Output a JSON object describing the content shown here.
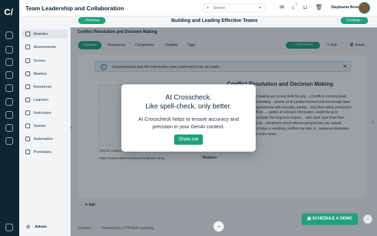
{
  "app": {
    "title": "Team Leadership and Collaboration"
  },
  "topbar": {
    "search_placeholder": "Search",
    "user_name": "Stephanie Brown",
    "badge_count": "3"
  },
  "sidebar": {
    "items": [
      {
        "label": "Modules",
        "icon": "modules-icon"
      },
      {
        "label": "Assessments",
        "icon": "assessments-icon"
      },
      {
        "label": "Scores",
        "icon": "scores-icon"
      },
      {
        "label": "Mastery",
        "icon": "mastery-icon"
      },
      {
        "label": "Resources",
        "icon": "resources-icon"
      },
      {
        "label": "Learners",
        "icon": "learners-icon"
      },
      {
        "label": "Instructors",
        "icon": "instructors-icon"
      },
      {
        "label": "Games",
        "icon": "games-icon"
      },
      {
        "label": "Automation",
        "icon": "automation-icon"
      },
      {
        "label": "Purchases",
        "icon": "purchases-icon"
      }
    ],
    "admin_label": "Admin"
  },
  "header": {
    "previous_label": "Previous",
    "page_title": "Building and Leading Effective Teams",
    "continue_label": "Continue"
  },
  "section": {
    "title": "Conflict Resolution and Decision Making",
    "tabs": [
      "Content",
      "Resources",
      "Completion",
      "Visibility",
      "Tags"
    ],
    "add_section_label": "Add section",
    "edit_label": "Edit",
    "delete_label": "Delete"
  },
  "banner": {
    "text": "Crosschecked and the information was confirmed to be accurate."
  },
  "content": {
    "title": "Conflict Resolution and Decision Making",
    "body": "...and decision making are crucial skills for any ...y conflicts constructively, focus on understanding ...terests of all parties involved and encourage open ...pproach disagreements with empathy, aiming ...ions that satisfy everyone's core needs. When ..., gather all relevant information, weigh the pros ...option, and consider the long-term impact. ...also seek input from their team, fostering an ...vironment where diverse perspectives are valued. ...skills not only helps in resolving conflicts but also in ...balanced decisions that benefit the entire team.",
    "copyright": "May be subject to copyright",
    "url": "https://www.culturemonkey.io/employee-eng...",
    "replace_label": "Replace",
    "edit_label": "Edit"
  },
  "modal": {
    "title_line1": "AI Crosscheck.",
    "title_line2": "Like spell-check, only better.",
    "text": "AI Crosscheck helps to ensure accuracy and precision in your GenAI content.",
    "button_label": "Show me"
  },
  "footer": {
    "contact": "Contact",
    "powered": "Powered by CYPHER Learning",
    "schedule_label": "SCHEDULE A DEMO"
  }
}
